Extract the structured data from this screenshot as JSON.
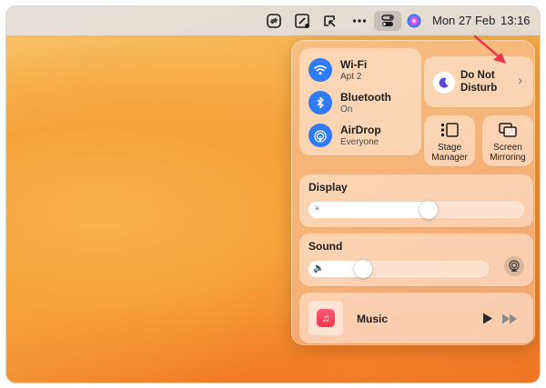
{
  "menubar": {
    "date": "Mon 27 Feb",
    "time": "13:16",
    "icons": [
      "sync-icon",
      "edit-screenshot-icon",
      "window-icon",
      "more-dots-icon",
      "control-center-icon",
      "siri-icon"
    ]
  },
  "network": {
    "wifi": {
      "title": "Wi-Fi",
      "subtitle": "Apt 2"
    },
    "bluetooth": {
      "title": "Bluetooth",
      "subtitle": "On"
    },
    "airdrop": {
      "title": "AirDrop",
      "subtitle": "Everyone"
    }
  },
  "dnd": {
    "label": "Do Not Disturb",
    "chevron": "›"
  },
  "stage_manager": {
    "label": "Stage Manager"
  },
  "screen_mirroring": {
    "label": "Screen Mirroring"
  },
  "display": {
    "title": "Display",
    "level": 0.56
  },
  "sound": {
    "title": "Sound",
    "level": 0.28
  },
  "music": {
    "title": "Music"
  },
  "colors": {
    "accent": "#2f7af5",
    "arrow": "#e8344a",
    "music_app": "#f9314d"
  }
}
